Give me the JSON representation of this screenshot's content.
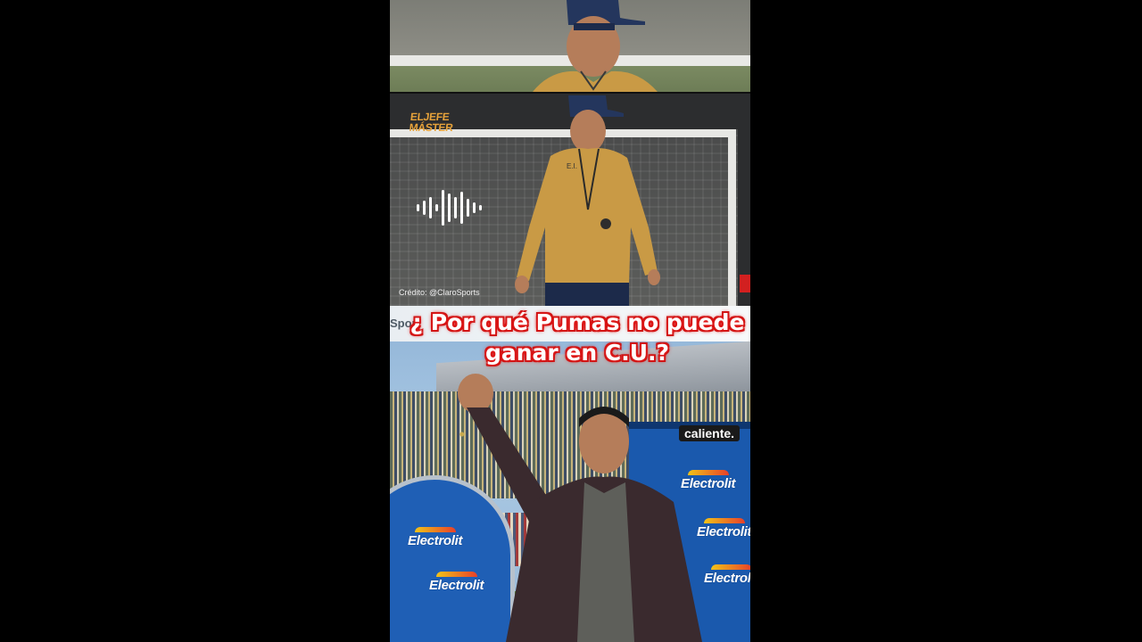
{
  "brand_logo": {
    "line1": "ELJEFE",
    "line2": "MÁSTER"
  },
  "photo_credit": "Crédito: @ClaroSports",
  "strip_text": "Spor",
  "headline": {
    "line1": "¿ Por qué Pumas no puede",
    "line2": "ganar en C.U.?"
  },
  "sponsors": {
    "caliente": "caliente.",
    "electrolit": "Electrolit"
  },
  "shirt_initials": "E.I.",
  "icons": [
    "audio-waveform-icon"
  ],
  "colors": {
    "headline_glow": "#e11b1b",
    "brand_logo": "#e6a23a",
    "pumas_gold": "#c99a45",
    "pumas_navy": "#1c2a4a",
    "bench_blue": "#1f5fb5"
  }
}
